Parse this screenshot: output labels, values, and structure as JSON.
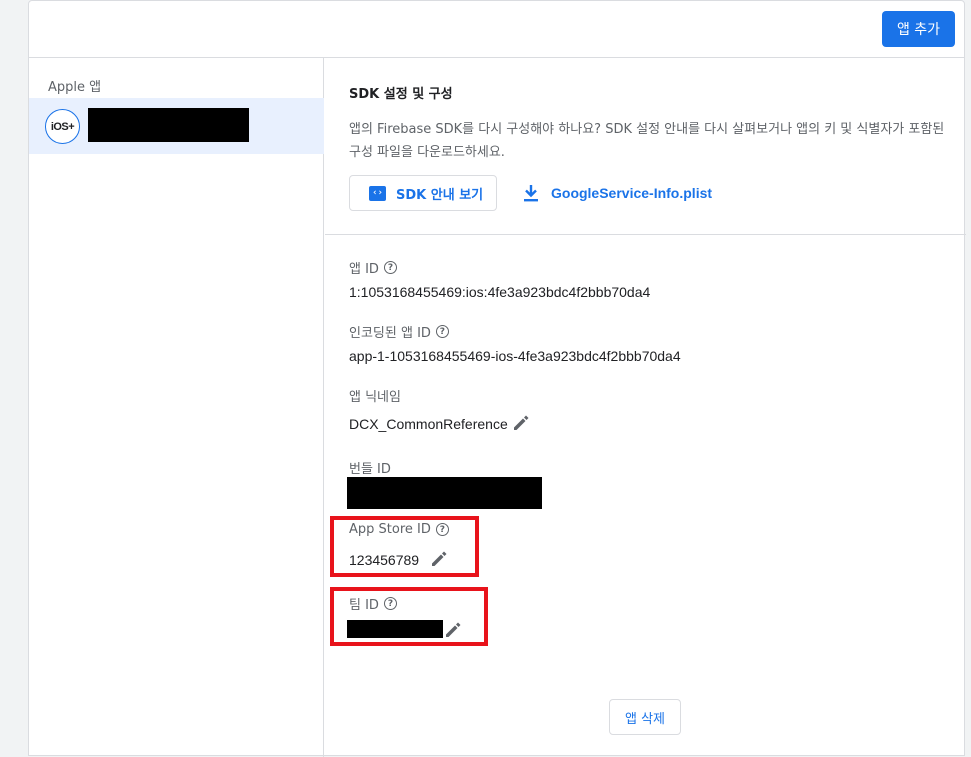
{
  "header": {
    "add_app_label": "앱 추가"
  },
  "sidebar": {
    "section_title": "Apple 앱",
    "selected_app": {
      "platform_badge": "iOS+"
    }
  },
  "sdk": {
    "title": "SDK 설정 및 구성",
    "description": "앱의 Firebase SDK를 다시 구성해야 하나요? SDK 설정 안내를 다시 살펴보거나 앱의 키 및 식별자가 포함된 구성 파일을 다운로드하세요.",
    "guide_button_label": "SDK 안내 보기",
    "config_file_link": "GoogleService-Info.plist"
  },
  "fields": {
    "app_id": {
      "label": "앱 ID",
      "value": "1:1053168455469:ios:4fe3a923bdc4f2bbb70da4"
    },
    "encoded_app_id": {
      "label": "인코딩된 앱 ID",
      "value": "app-1-1053168455469-ios-4fe3a923bdc4f2bbb70da4"
    },
    "nickname": {
      "label": "앱 닉네임",
      "value": "DCX_CommonReference"
    },
    "bundle_id": {
      "label": "번들 ID"
    },
    "app_store_id": {
      "label": "App Store ID",
      "value": "123456789"
    },
    "team_id": {
      "label": "팀 ID"
    }
  },
  "footer": {
    "delete_label": "앱 삭제"
  },
  "colors": {
    "accent": "#1a73e8",
    "highlight": "#e8131b",
    "selected_bg": "#e8f0fe"
  }
}
